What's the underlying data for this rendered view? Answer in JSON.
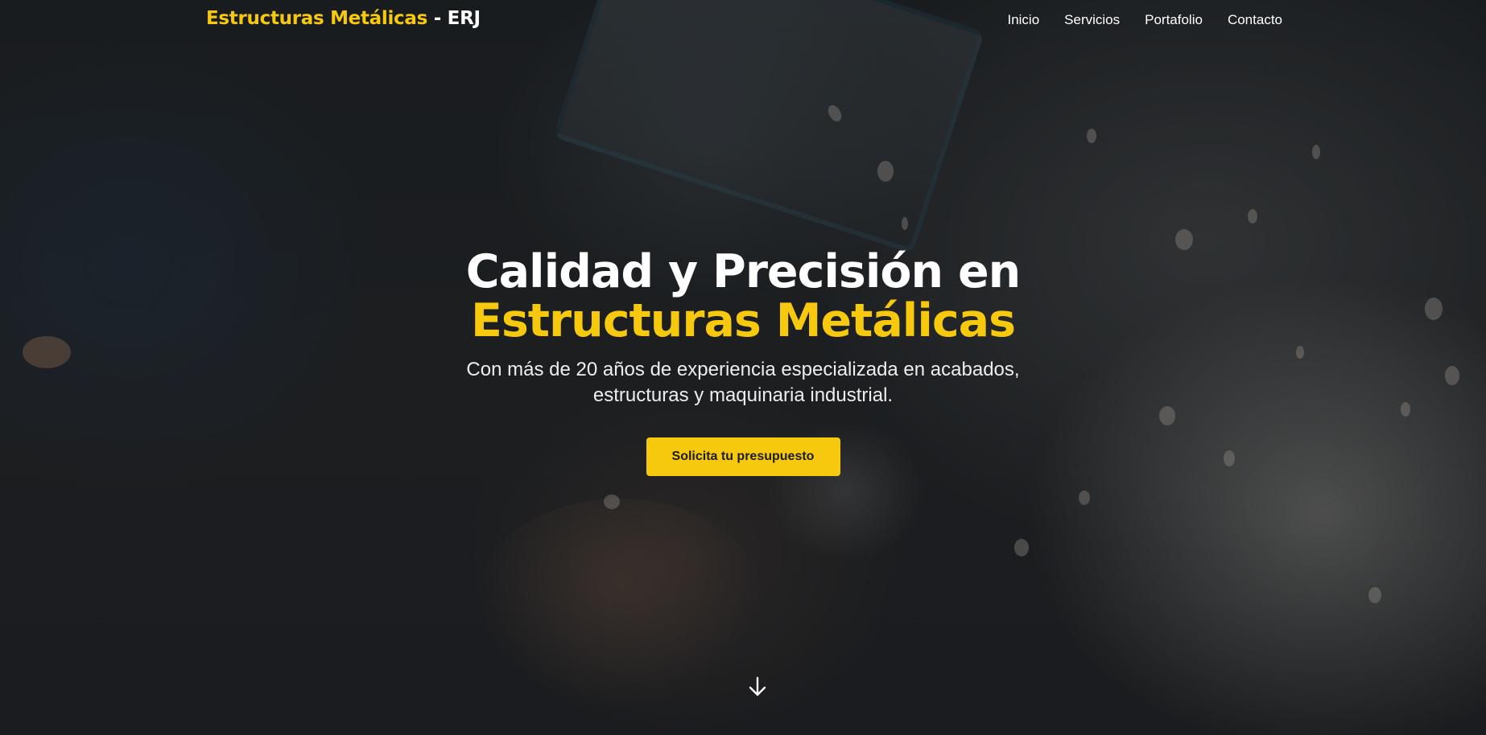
{
  "navbar": {
    "brand_primary": "Estructuras Metálicas",
    "brand_secondary": " - ERJ",
    "links": [
      {
        "label": "Inicio"
      },
      {
        "label": "Servicios"
      },
      {
        "label": "Portafolio"
      },
      {
        "label": "Contacto"
      }
    ]
  },
  "hero": {
    "title_line1": "Calidad y Precisión en",
    "title_line2": "Estructuras Metálicas",
    "subtitle": "Con más de 20 años de experiencia especializada en acabados, estructuras y maquinaria industrial.",
    "cta_label": "Solicita tu presupuesto",
    "scroll_icon": "arrow-down-icon"
  },
  "colors": {
    "accent": "#f6c90e",
    "text": "#ffffff",
    "background": "#1f2123"
  }
}
